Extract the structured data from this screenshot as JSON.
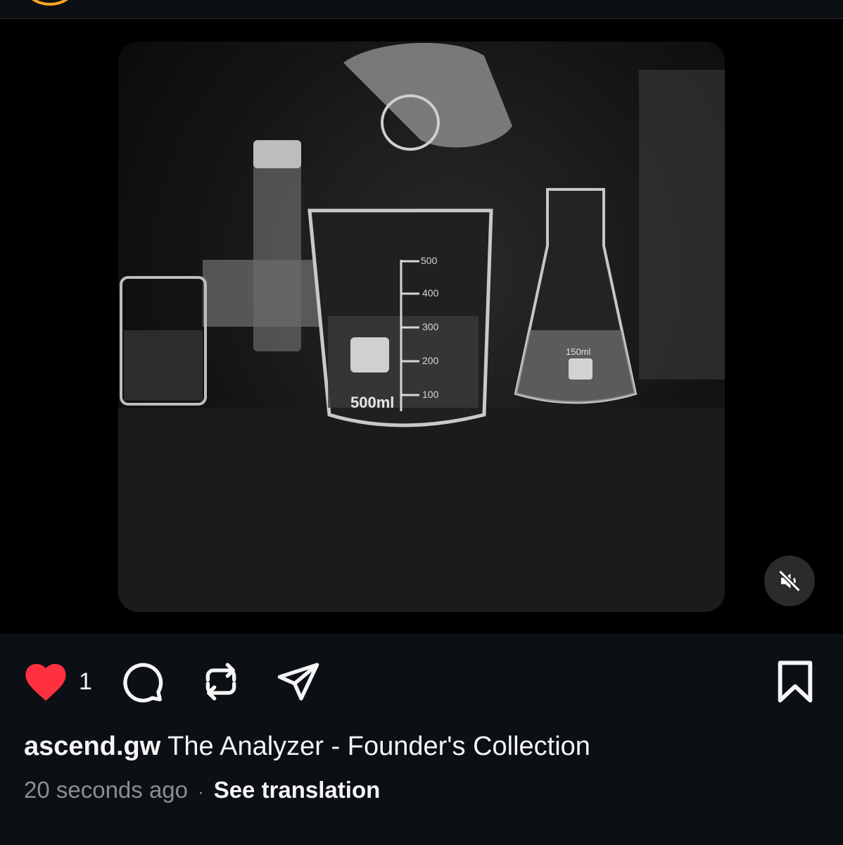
{
  "post": {
    "media": {
      "description_icon": "video-still",
      "beaker_large_label": "500ml",
      "beaker_scale": [
        "500",
        "400",
        "300",
        "200",
        "100"
      ],
      "flask_label": "150ml",
      "mute_icon": "speaker-muted-icon"
    },
    "actions": {
      "like_icon": "heart-filled-icon",
      "like_count": "1",
      "comment_icon": "comment-icon",
      "repost_icon": "repost-icon",
      "share_icon": "send-icon",
      "save_icon": "bookmark-icon"
    },
    "caption": {
      "username": "ascend.gw",
      "text": "The Analyzer - Founder's Collection"
    },
    "meta": {
      "timestamp": "20 seconds ago",
      "separator": "·",
      "translate_link": "See translation"
    }
  },
  "colors": {
    "background": "#0c1014",
    "like_red": "#ff3040",
    "story_ring": "#f6a623",
    "muted_text": "#8e8e8e"
  }
}
